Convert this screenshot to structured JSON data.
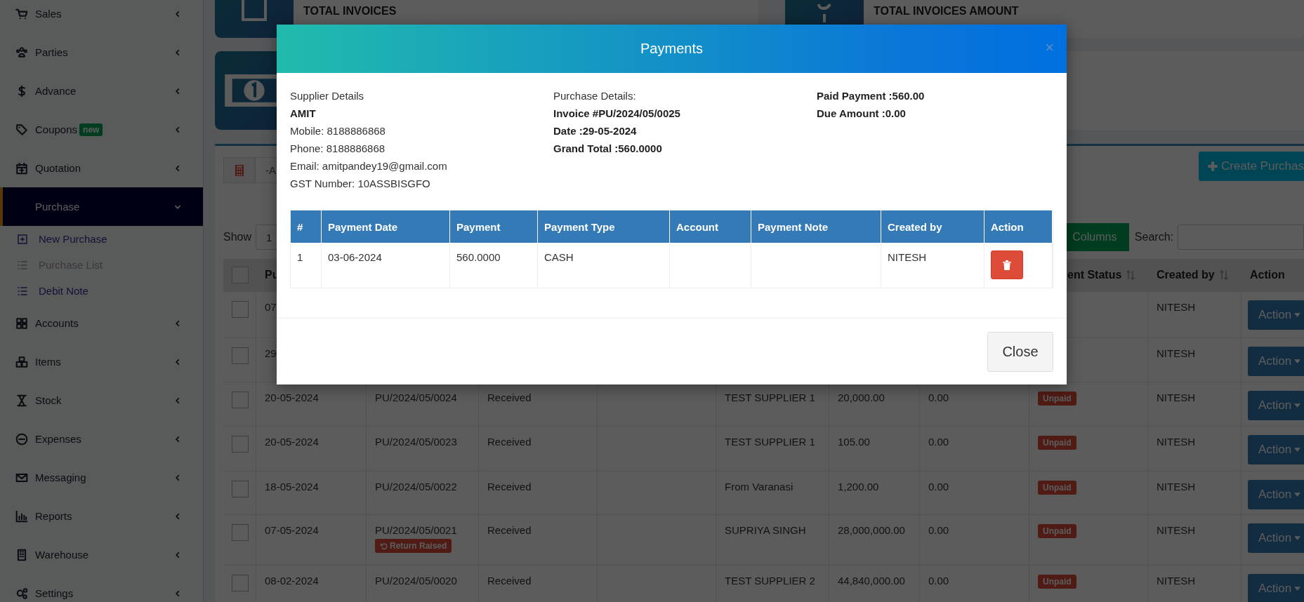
{
  "sidebar": {
    "items": [
      {
        "label": "Sales",
        "selected": false,
        "expanded": false
      },
      {
        "label": "Parties",
        "selected": false,
        "expanded": false
      },
      {
        "label": "Advance",
        "selected": false,
        "expanded": false
      },
      {
        "label": "Coupons",
        "badge": "new",
        "selected": false,
        "expanded": false
      },
      {
        "label": "Quotation",
        "selected": false,
        "expanded": false
      },
      {
        "label": "Purchase",
        "selected": true,
        "expanded": true,
        "children": [
          {
            "label": "New Purchase",
            "selected": false
          },
          {
            "label": "Purchase List",
            "selected": true
          },
          {
            "label": "Debit Note",
            "selected": false
          }
        ]
      },
      {
        "label": "Accounts",
        "selected": false,
        "expanded": false
      },
      {
        "label": "Items",
        "selected": false,
        "expanded": false
      },
      {
        "label": "Stock",
        "selected": false,
        "expanded": false
      },
      {
        "label": "Expenses",
        "selected": false,
        "expanded": false
      },
      {
        "label": "Messaging",
        "selected": false,
        "expanded": false
      },
      {
        "label": "Reports",
        "selected": false,
        "expanded": false
      },
      {
        "label": "Warehouse",
        "selected": false,
        "expanded": false
      },
      {
        "label": "Settings",
        "selected": false,
        "expanded": false
      }
    ]
  },
  "info_boxes": [
    {
      "title": "TOTAL INVOICES"
    },
    {
      "title": "TOTAL INVOICES AMOUNT"
    }
  ],
  "toolbar": {
    "select_value": "-A",
    "create_button": "Create Purchas"
  },
  "list_controls": {
    "show_label": "Show",
    "page_size": "1",
    "columns_button": "Columns",
    "search_label": "Search:"
  },
  "purchases": {
    "select_all_checked": false,
    "columns": [
      {
        "label": "Pu"
      },
      {
        "label": "ent Status",
        "sortable": true
      },
      {
        "label": "Created by",
        "sortable": true
      },
      {
        "label": "Action"
      }
    ],
    "rows": [
      {
        "checked": false,
        "date": "07",
        "created_by": "NITESH",
        "action": "Action"
      },
      {
        "checked": false,
        "date": "29",
        "created_by": "NITESH",
        "action": "Action"
      },
      {
        "checked": false,
        "date": "20-05-2024",
        "ref": "PU/2024/05/0024",
        "status": "Received",
        "supplier": "TEST SUPPLIER 1",
        "total": "20,000.00",
        "paid": "0.00",
        "payment_status": "Unpaid",
        "created_by": "NITESH",
        "action": "Action"
      },
      {
        "checked": false,
        "date": "20-05-2024",
        "ref": "PU/2024/05/0023",
        "status": "Received",
        "supplier": "TEST SUPPLIER 1",
        "total": "105.00",
        "paid": "0.00",
        "payment_status": "Unpaid",
        "created_by": "NITESH",
        "action": "Action"
      },
      {
        "checked": false,
        "date": "18-05-2024",
        "ref": "PU/2024/05/0022",
        "status": "Received",
        "supplier": "From Varanasi",
        "total": "1,200.00",
        "paid": "0.00",
        "payment_status": "Unpaid",
        "created_by": "NITESH",
        "action": "Action"
      },
      {
        "checked": false,
        "date": "07-05-2024",
        "ref": "PU/2024/05/0021",
        "return_badge": "Return Raised",
        "status": "Received",
        "supplier": "SUPRIYA SINGH",
        "total": "28,000,000.00",
        "paid": "0.00",
        "payment_status": "Unpaid",
        "created_by": "NITESH",
        "action": "Action"
      },
      {
        "checked": false,
        "date": "08-02-2024",
        "ref": "PU/2024/05/0020",
        "status": "Received",
        "supplier": "TEST SUPPLIER 2",
        "total": "44,840,000.00",
        "paid": "0.00",
        "payment_status": "Unpaid",
        "created_by": "NITESH",
        "action": "Action"
      }
    ]
  },
  "modal": {
    "title": "Payments",
    "close": "×",
    "supplier": {
      "heading": "Supplier Details",
      "name": "AMIT",
      "lines": [
        "Mobile: 8188886868",
        "Phone: 8188886868",
        "Email: amitpandey19@gmail.com",
        "GST Number: 10ASSBISGFO"
      ]
    },
    "purchase": {
      "heading": "Purchase Details:",
      "lines": [
        "Invoice #PU/2024/05/0025",
        "Date :29-05-2024",
        "Grand Total :560.0000"
      ]
    },
    "summary": [
      "Paid Payment :560.00",
      "Due Amount :0.00"
    ],
    "table": {
      "columns": [
        "#",
        "Payment Date",
        "Payment",
        "Payment Type",
        "Account",
        "Payment Note",
        "Created by",
        "Action"
      ],
      "rows": [
        {
          "number": "1",
          "payment_date": "03-06-2024",
          "payment": "560.0000",
          "payment_type": "CASH",
          "created_by": "NITESH"
        }
      ]
    },
    "footer_button": "Close"
  }
}
